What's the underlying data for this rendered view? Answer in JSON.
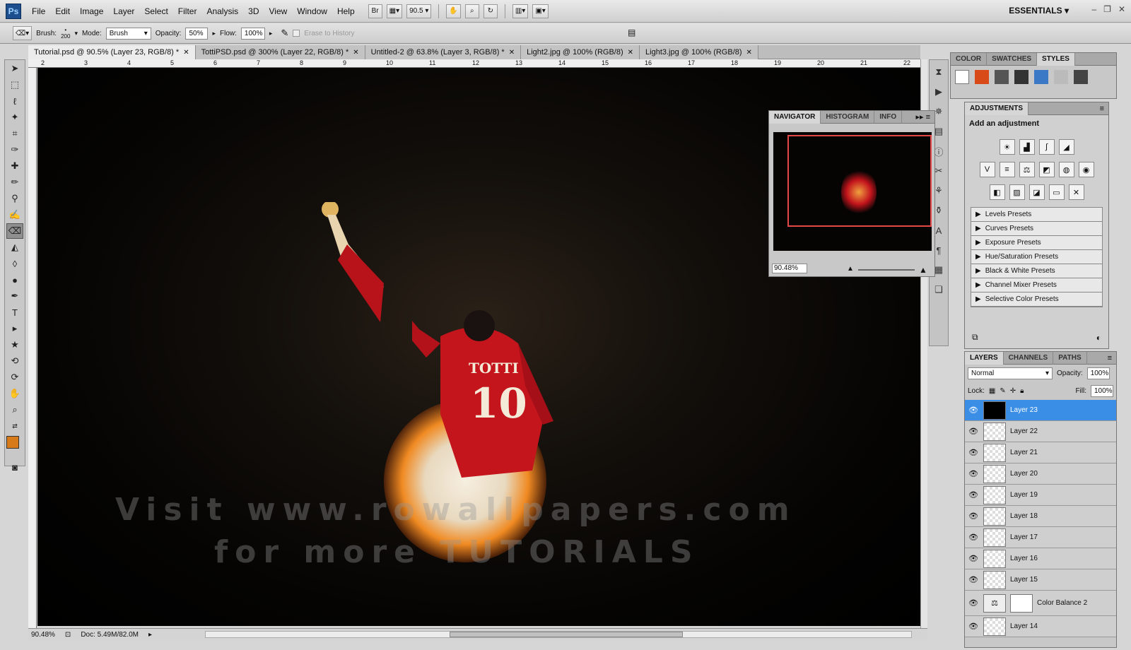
{
  "app": {
    "logo": "Ps",
    "workspace": "ESSENTIALS"
  },
  "menu": [
    "File",
    "Edit",
    "Image",
    "Layer",
    "Select",
    "Filter",
    "Analysis",
    "3D",
    "View",
    "Window",
    "Help"
  ],
  "menubar_tools": {
    "bridge": "Br",
    "zoom": "90.5"
  },
  "options": {
    "brush_label": "Brush:",
    "brush_size": "200",
    "mode_label": "Mode:",
    "mode_value": "Brush",
    "opacity_label": "Opacity:",
    "opacity_value": "50%",
    "flow_label": "Flow:",
    "flow_value": "100%",
    "erase_history": "Erase to History"
  },
  "tabs": [
    {
      "label": "Tutorial.psd @ 90.5% (Layer 23, RGB/8) *",
      "active": true
    },
    {
      "label": "TottiPSD.psd @ 300% (Layer 22, RGB/8) *"
    },
    {
      "label": "Untitled-2 @ 63.8% (Layer 3, RGB/8) *"
    },
    {
      "label": "Light2.jpg @ 100% (RGB/8)"
    },
    {
      "label": "Light3.jpg @ 100% (RGB/8)"
    }
  ],
  "ruler_top": [
    "2",
    "3",
    "4",
    "5",
    "6",
    "7",
    "8",
    "9",
    "10",
    "11",
    "12",
    "13",
    "14",
    "15",
    "16",
    "17",
    "18",
    "19",
    "20",
    "21",
    "22"
  ],
  "canvas": {
    "jersey_name": "TOTTI",
    "jersey_number": "10",
    "watermark_line1": "Visit www.rowallpapers.com",
    "watermark_line2": "for more TUTORIALS"
  },
  "status": {
    "zoom": "90.48%",
    "doc": "Doc: 5.49M/82.0M"
  },
  "navigator": {
    "tabs": [
      "NAVIGATOR",
      "HISTOGRAM",
      "INFO"
    ],
    "zoom": "90.48%"
  },
  "color_panel": {
    "tabs": [
      "COLOR",
      "SWATCHES",
      "STYLES"
    ]
  },
  "adjustments": {
    "header": "ADJUSTMENTS",
    "title": "Add an adjustment",
    "presets": [
      "Levels Presets",
      "Curves Presets",
      "Exposure Presets",
      "Hue/Saturation Presets",
      "Black & White Presets",
      "Channel Mixer Presets",
      "Selective Color Presets"
    ]
  },
  "layers_panel": {
    "tabs": [
      "LAYERS",
      "CHANNELS",
      "PATHS"
    ],
    "blend": "Normal",
    "opacity_label": "Opacity:",
    "opacity": "100%",
    "lock_label": "Lock:",
    "fill_label": "Fill:",
    "fill": "100%",
    "layers": [
      "Layer 23",
      "Layer 22",
      "Layer 21",
      "Layer 20",
      "Layer 19",
      "Layer 18",
      "Layer 17",
      "Layer 16",
      "Layer 15",
      "Color Balance 2",
      "Layer 14"
    ]
  },
  "colors": {
    "accent": "#3a8ee6",
    "foreground": "#d77a1a",
    "nav_rect": "#e34848"
  }
}
